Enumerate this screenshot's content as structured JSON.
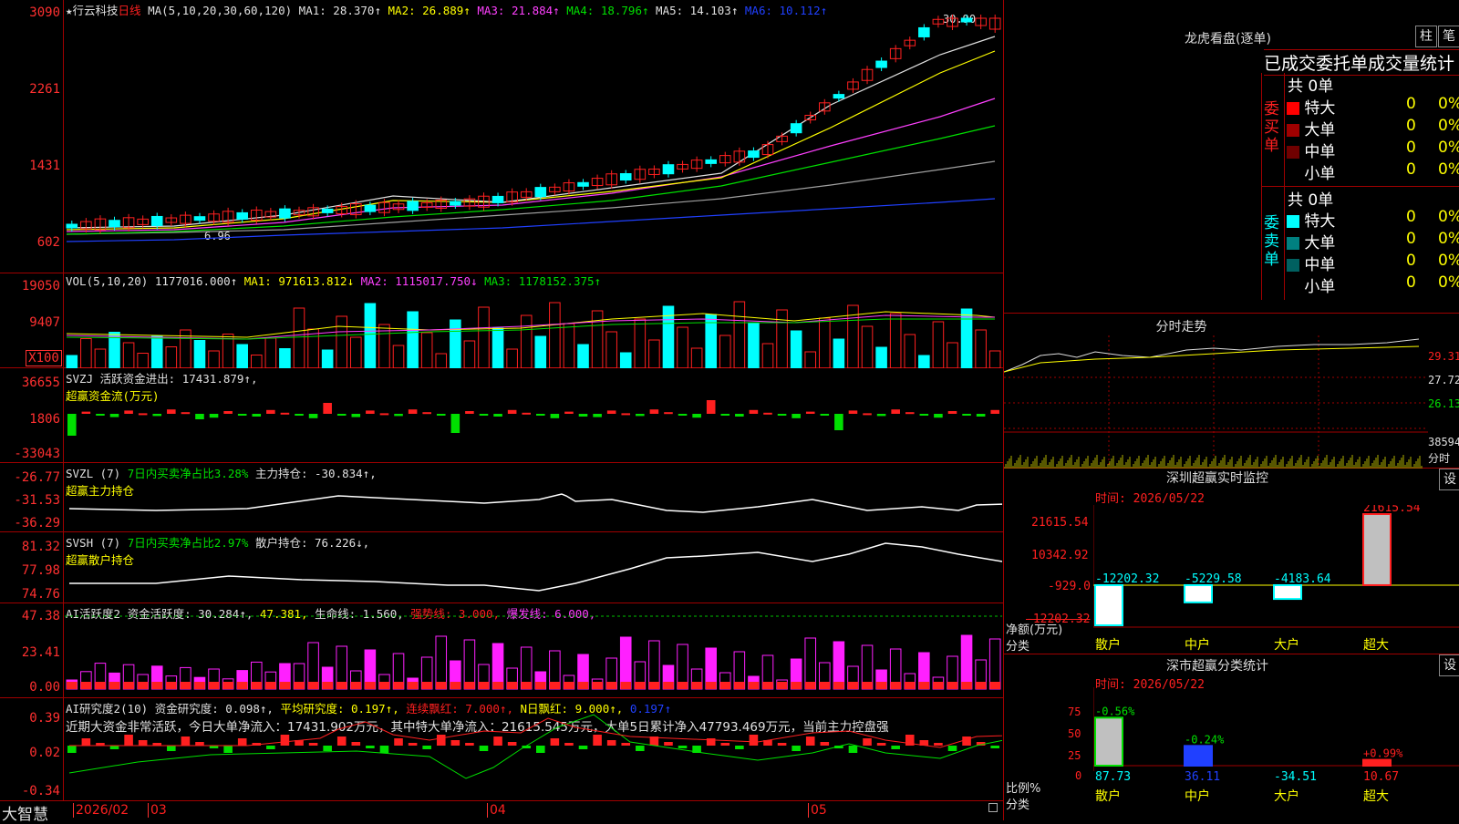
{
  "stock": {
    "star": "★",
    "name": "行云科技",
    "period": "日线"
  },
  "ma_header": {
    "params": "MA(5,10,20,30,60,120)",
    "ma1": "MA1: 28.370↑",
    "ma2": "MA2: 26.889↑",
    "ma3": "MA3: 21.884↑",
    "ma4": "MA4: 18.796↑",
    "ma5": "MA5: 14.103↑",
    "ma6": "MA6: 10.112↑"
  },
  "price_axis": [
    "3090",
    "2261",
    "1431",
    "602"
  ],
  "price_annotations": {
    "high": "30.90",
    "low": "6.96"
  },
  "vol_header": {
    "params": "VOL(5,10,20)",
    "v": "1177016.000↑",
    "ma1": "MA1: 971613.812↓",
    "ma2": "MA2: 1115017.750↓",
    "ma3": "MA3: 1178152.375↑"
  },
  "vol_axis": [
    "19050",
    "9407",
    "X100"
  ],
  "svzj": {
    "label": "SVZJ",
    "desc": "活跃资金进出: 17431.879↑,",
    "sub": "超赢资金流(万元)",
    "axis": [
      "36655",
      "1806",
      "-33043"
    ]
  },
  "svzl": {
    "label": "SVZL (7)",
    "pct": "7日内买卖净占比3.28%",
    "hold": "主力持仓: -30.834↑,",
    "sub": "超赢主力持仓",
    "axis": [
      "-26.77",
      "-31.53",
      "-36.29"
    ]
  },
  "svsh": {
    "label": "SVSH (7)",
    "pct": "7日内买卖净占比2.97%",
    "hold": "散户持仓: 76.226↓,",
    "sub": "超赢散户持仓",
    "axis": [
      "81.32",
      "77.98",
      "74.76"
    ]
  },
  "ai1": {
    "label": "AI活跃度2",
    "a": "资金活跃度: 30.284↑,",
    "b": "47.381,",
    "c": "生命线: 1.560,",
    "d": "强势线: 3.000,",
    "e": "爆发线: 6.000,",
    "axis": [
      "47.38",
      "23.41",
      "0.00"
    ]
  },
  "ai2": {
    "label": "AI研究度2(10)",
    "a": "资金研究度: 0.098↑,",
    "b": "平均研究度: 0.197↑,",
    "c": "连续飘红: 7.000↑,",
    "d": "N日飘红: 9.000↑,",
    "e": "0.197↑",
    "note": "近期大资金非常活跃，今日大单净流入：17431.902万元，其中特大单净流入：21615.545万元，大单5日累计净入47793.469万元，当前主力控盘强",
    "axis": [
      "0.39",
      "0.02",
      "-0.34"
    ]
  },
  "date_axis": {
    "logo": "大智慧",
    "labels": [
      "2026/02",
      "03",
      "04",
      "05"
    ]
  },
  "lhb": {
    "title": "龙虎看盘(逐单)",
    "btn1": "柱",
    "btn2": "笔",
    "header": "已成交委托单成交量统计",
    "buy": {
      "side": "委买单",
      "total": "共 0单",
      "rows": [
        {
          "name": "特大",
          "n": "0",
          "p": "0%",
          "color": "#ff0000"
        },
        {
          "name": "大单",
          "n": "0",
          "p": "0%",
          "color": "#a00000"
        },
        {
          "name": "中单",
          "n": "0",
          "p": "0%",
          "color": "#700000"
        },
        {
          "name": "小单",
          "n": "0",
          "p": "0%",
          "color": ""
        }
      ]
    },
    "sell": {
      "side": "委卖单",
      "total": "共 0单",
      "rows": [
        {
          "name": "特大",
          "n": "0",
          "p": "0%",
          "color": "#00ffff"
        },
        {
          "name": "大单",
          "n": "0",
          "p": "0%",
          "color": "#008080"
        },
        {
          "name": "中单",
          "n": "0",
          "p": "0%",
          "color": "#006060"
        },
        {
          "name": "小单",
          "n": "0",
          "p": "0%",
          "color": ""
        }
      ]
    }
  },
  "fenshi": {
    "title": "分时走势",
    "axis": [
      "29.31",
      "27.72",
      "26.13"
    ],
    "vol_label": "38594",
    "unit": "分时"
  },
  "sz_monitor": {
    "title": "深圳超赢实时监控",
    "btn": "设",
    "time": "时间: 2026/05/22",
    "axis": [
      "21615.54",
      "10342.92",
      "-929.0",
      "-12202.32"
    ],
    "ylabel": "净额(万元)",
    "xlabel": "分类",
    "cats": [
      "散户",
      "中户",
      "大户",
      "超大"
    ],
    "values": [
      -12202.32,
      -5229.58,
      -4183.64,
      21615.54
    ],
    "labels": [
      "-12202.32",
      "-5229.58",
      "-4183.64",
      "21615.54"
    ]
  },
  "sz_class": {
    "title": "深市超赢分类统计",
    "btn": "设",
    "time": "时间: 2026/05/22",
    "axis": [
      "75",
      "50",
      "25",
      "0"
    ],
    "ylabel": "比例%",
    "xlabel": "分类",
    "cats": [
      "散户",
      "中户",
      "大户",
      "超大"
    ],
    "values": [
      87.73,
      36.11,
      -34.51,
      10.67
    ],
    "labels": [
      "87.73",
      "36.11",
      "-34.51",
      "10.67"
    ],
    "changes": [
      "-0.56%",
      "-0.24%",
      "",
      "+0.99%"
    ]
  }
}
